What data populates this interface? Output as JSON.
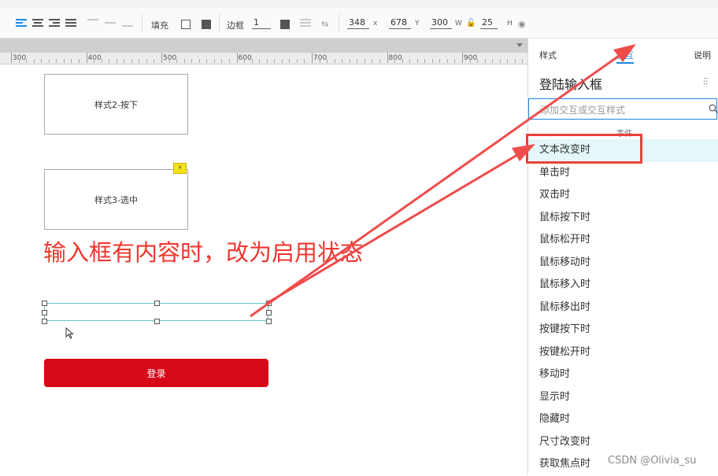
{
  "toolbar": {
    "fill_label": "填充",
    "border_label": "边框",
    "border_value": "1",
    "x_value": "348",
    "y_value": "678",
    "w_value": "300",
    "h_value": "25",
    "x_axis": "x",
    "y_axis": "Y",
    "w_axis": "W",
    "h_axis": "H"
  },
  "ruler": {
    "labels": [
      "300",
      "400",
      "500",
      "600",
      "700",
      "800",
      "900"
    ]
  },
  "canvas": {
    "box1_label": "样式2-按下",
    "box2_label": "样式3-选中",
    "badge_icon": "lightning-icon",
    "annotation": "输入框有内容时，改为启用状态",
    "login_label": "登录",
    "annotation_color": "#f0362e",
    "login_color": "#d6081a"
  },
  "panel": {
    "tabs": [
      "样式",
      "交互",
      "说明"
    ],
    "title": "登陆输入框",
    "search_placeholder": "添加交互或交互样式",
    "section_label": "事件",
    "events": [
      "文本改变时",
      "单击时",
      "双击时",
      "鼠标按下时",
      "鼠标松开时",
      "鼠标移动时",
      "鼠标移入时",
      "鼠标移出时",
      "按键按下时",
      "按键松开时",
      "移动时",
      "显示时",
      "隐藏时",
      "尺寸改变时",
      "获取焦点时"
    ],
    "accent_color": "#1e88e5"
  },
  "watermark": "CSDN @Olivia_su"
}
